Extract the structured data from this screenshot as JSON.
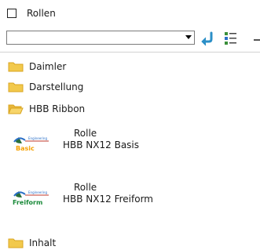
{
  "header": {
    "title": "Rollen"
  },
  "filter": {
    "value": ""
  },
  "folders": [
    {
      "label": "Daimler",
      "open": false
    },
    {
      "label": "Darstellung",
      "open": false
    },
    {
      "label": "HBB Ribbon",
      "open": true
    }
  ],
  "roles": [
    {
      "type": "Rolle",
      "name": "HBB NX12 Basis",
      "logo_text": "Basic",
      "logo_color": "#f5a000"
    },
    {
      "type": "Rolle",
      "name": "HBB NX12 Freiform",
      "logo_text": "Freiform",
      "logo_color": "#1a8a3a"
    }
  ],
  "bottom_folder": {
    "label": "Inhalt"
  },
  "colors": {
    "folder": "#f2c94c",
    "folder_dark": "#d9a520",
    "accent": "#2b8fc7"
  }
}
